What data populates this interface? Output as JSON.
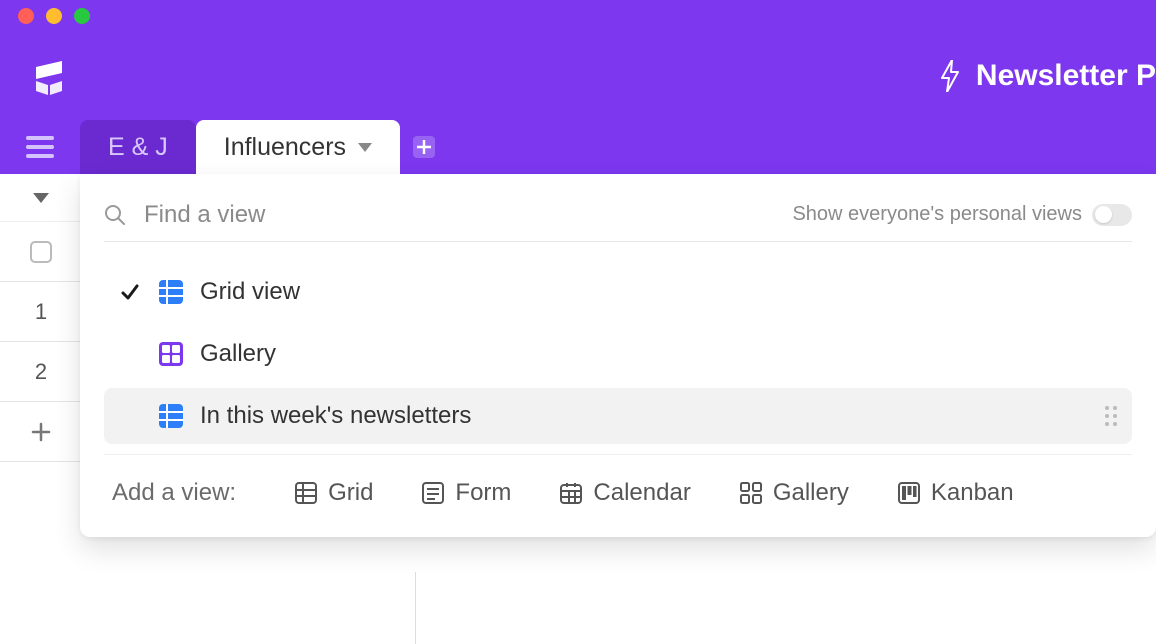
{
  "header": {
    "title": "Newsletter P"
  },
  "tabs": {
    "inactive": "E & J",
    "active": "Influencers"
  },
  "rownums": {
    "r1": "1",
    "r2": "2"
  },
  "panel": {
    "search_placeholder": "Find a view",
    "toggle_label": "Show everyone's personal views",
    "views": [
      {
        "label": "Grid view"
      },
      {
        "label": "Gallery"
      },
      {
        "label": "In this week's newsletters"
      }
    ],
    "add_label": "Add a view:",
    "options": {
      "grid": "Grid",
      "form": "Form",
      "calendar": "Calendar",
      "gallery": "Gallery",
      "kanban": "Kanban"
    }
  }
}
